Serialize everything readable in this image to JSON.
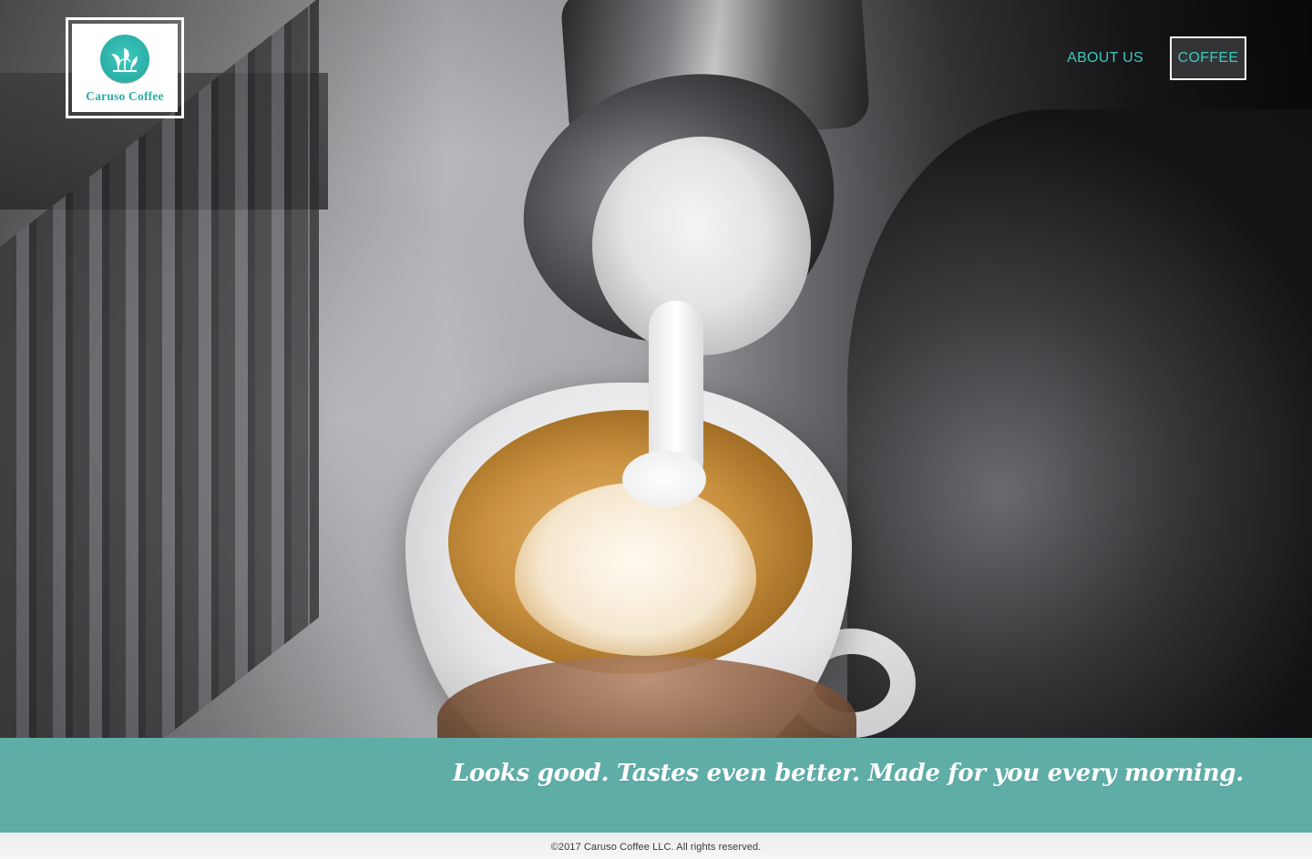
{
  "header": {
    "logo": {
      "brand_name": "Caruso Coffee",
      "icon": "sprout-leaves-icon"
    },
    "nav": {
      "items": [
        {
          "label": "ABOUT US",
          "active": false
        },
        {
          "label": "COFFEE",
          "active": true
        }
      ]
    }
  },
  "hero": {
    "image": "latte-art-pour-photo"
  },
  "tagline": {
    "text": "Looks good. Tastes even better. Made for you every morning."
  },
  "footer": {
    "copyright": "©2017 Caruso Coffee LLC. All rights reserved."
  },
  "colors": {
    "accent": "#3cc9bd",
    "band": "#5fada7",
    "logo_teal": "#2aaea5",
    "active_nav_bg": "#37373a"
  }
}
